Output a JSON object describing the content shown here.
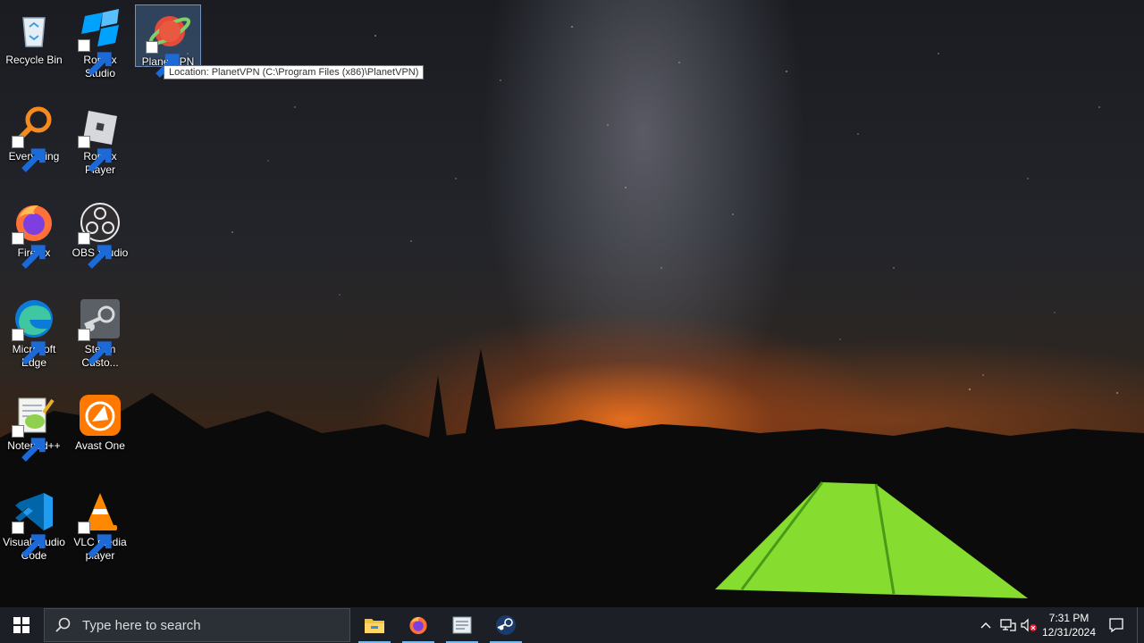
{
  "desktop": {
    "icons": [
      {
        "id": "recycle-bin",
        "label": "Recycle Bin",
        "icon": "recycle-bin-icon"
      },
      {
        "id": "roblox-studio",
        "label": "Roblox Studio",
        "icon": "roblox-studio-icon"
      },
      {
        "id": "planetvpn",
        "label": "PlanetVPN",
        "icon": "planetvpn-icon",
        "selected": true
      },
      {
        "id": "everything",
        "label": "Everything",
        "icon": "everything-search-icon"
      },
      {
        "id": "roblox-player",
        "label": "Roblox Player",
        "icon": "roblox-player-icon"
      },
      {
        "id": "firefox",
        "label": "Firefox",
        "icon": "firefox-icon"
      },
      {
        "id": "obs-studio",
        "label": "OBS Studio",
        "icon": "obs-studio-icon"
      },
      {
        "id": "microsoft-edge",
        "label": "Microsoft Edge",
        "icon": "edge-icon"
      },
      {
        "id": "steam",
        "label": "Steam Custo...",
        "icon": "steam-icon"
      },
      {
        "id": "notepadpp",
        "label": "Notepad++",
        "icon": "notepadpp-icon"
      },
      {
        "id": "avast-one",
        "label": "Avast One",
        "icon": "avast-icon"
      },
      {
        "id": "vscode",
        "label": "Visual Studio Code",
        "icon": "vscode-icon"
      },
      {
        "id": "vlc",
        "label": "VLC media player",
        "icon": "vlc-icon"
      }
    ],
    "tooltip": "Location: PlanetVPN (C:\\Program Files (x86)\\PlanetVPN)"
  },
  "taskbar": {
    "search_placeholder": "Type here to search",
    "pinned": [
      "file-explorer-icon",
      "firefox-icon",
      "notepad-icon",
      "steam-icon"
    ],
    "clock": {
      "time": "7:31 PM",
      "date": "12/31/2024"
    }
  },
  "colors": {
    "taskbar": "#1c1f25",
    "accent": "#76b9ed"
  }
}
